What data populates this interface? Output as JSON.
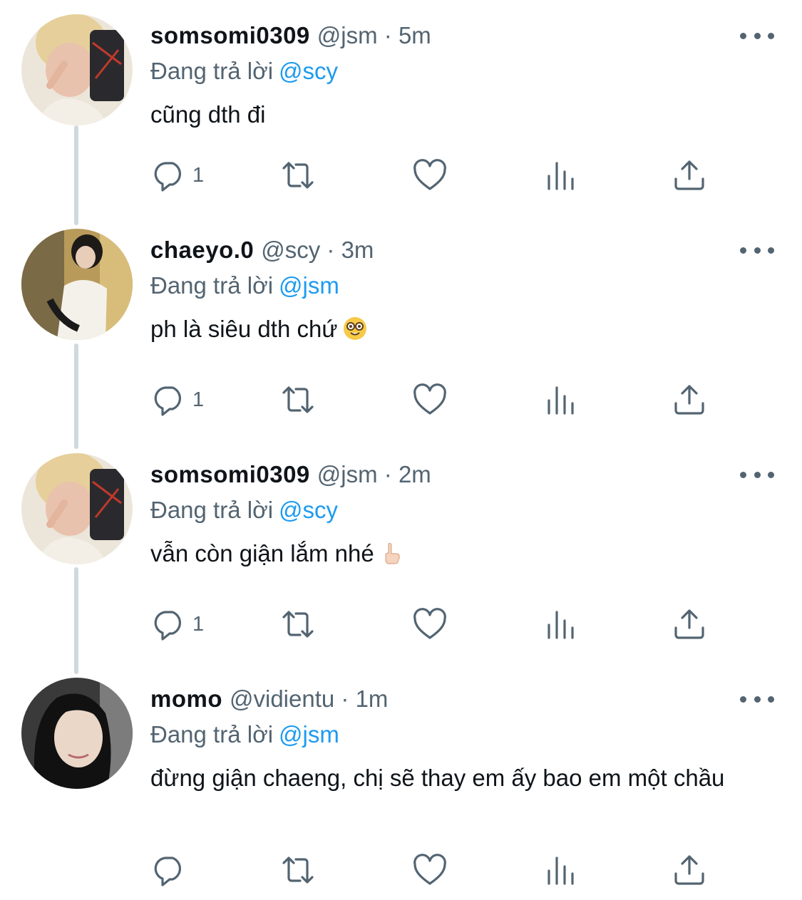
{
  "tweets": [
    {
      "name": "somsomi0309",
      "handle": "@jsm",
      "time": "· 5m",
      "replying_label": "Đang trả lời",
      "replying_to": "@scy",
      "text": "cũng dth đi",
      "emoji": "",
      "reply_count": "1"
    },
    {
      "name": "chaeyo.0",
      "handle": "@scy",
      "time": "· 3m",
      "replying_label": "Đang trả lời",
      "replying_to": "@jsm",
      "text": "ph là siêu dth chứ",
      "emoji": "nerd-face-emoji",
      "reply_count": "1"
    },
    {
      "name": "somsomi0309",
      "handle": "@jsm",
      "time": "· 2m",
      "replying_label": "Đang trả lời",
      "replying_to": "@scy",
      "text": "vẫn còn giận lắm nhé",
      "emoji": "pointing-up-hand-emoji",
      "reply_count": "1"
    },
    {
      "name": "momo",
      "handle": "@vidientu",
      "time": "· 1m",
      "replying_label": "Đang trả lời",
      "replying_to": "@jsm",
      "text": "đừng giận chaeng, chị sẽ thay em ấy bao em một chầu",
      "emoji": "",
      "reply_count": ""
    }
  ],
  "icons": {
    "reply": "reply-icon",
    "retweet": "retweet-icon",
    "like": "heart-icon",
    "views": "views-icon",
    "share": "share-icon",
    "more": "more-icon"
  },
  "colors": {
    "text": "#0f1419",
    "secondary": "#536471",
    "mention": "#1d9bf0",
    "thread_line": "#cfd9de"
  }
}
